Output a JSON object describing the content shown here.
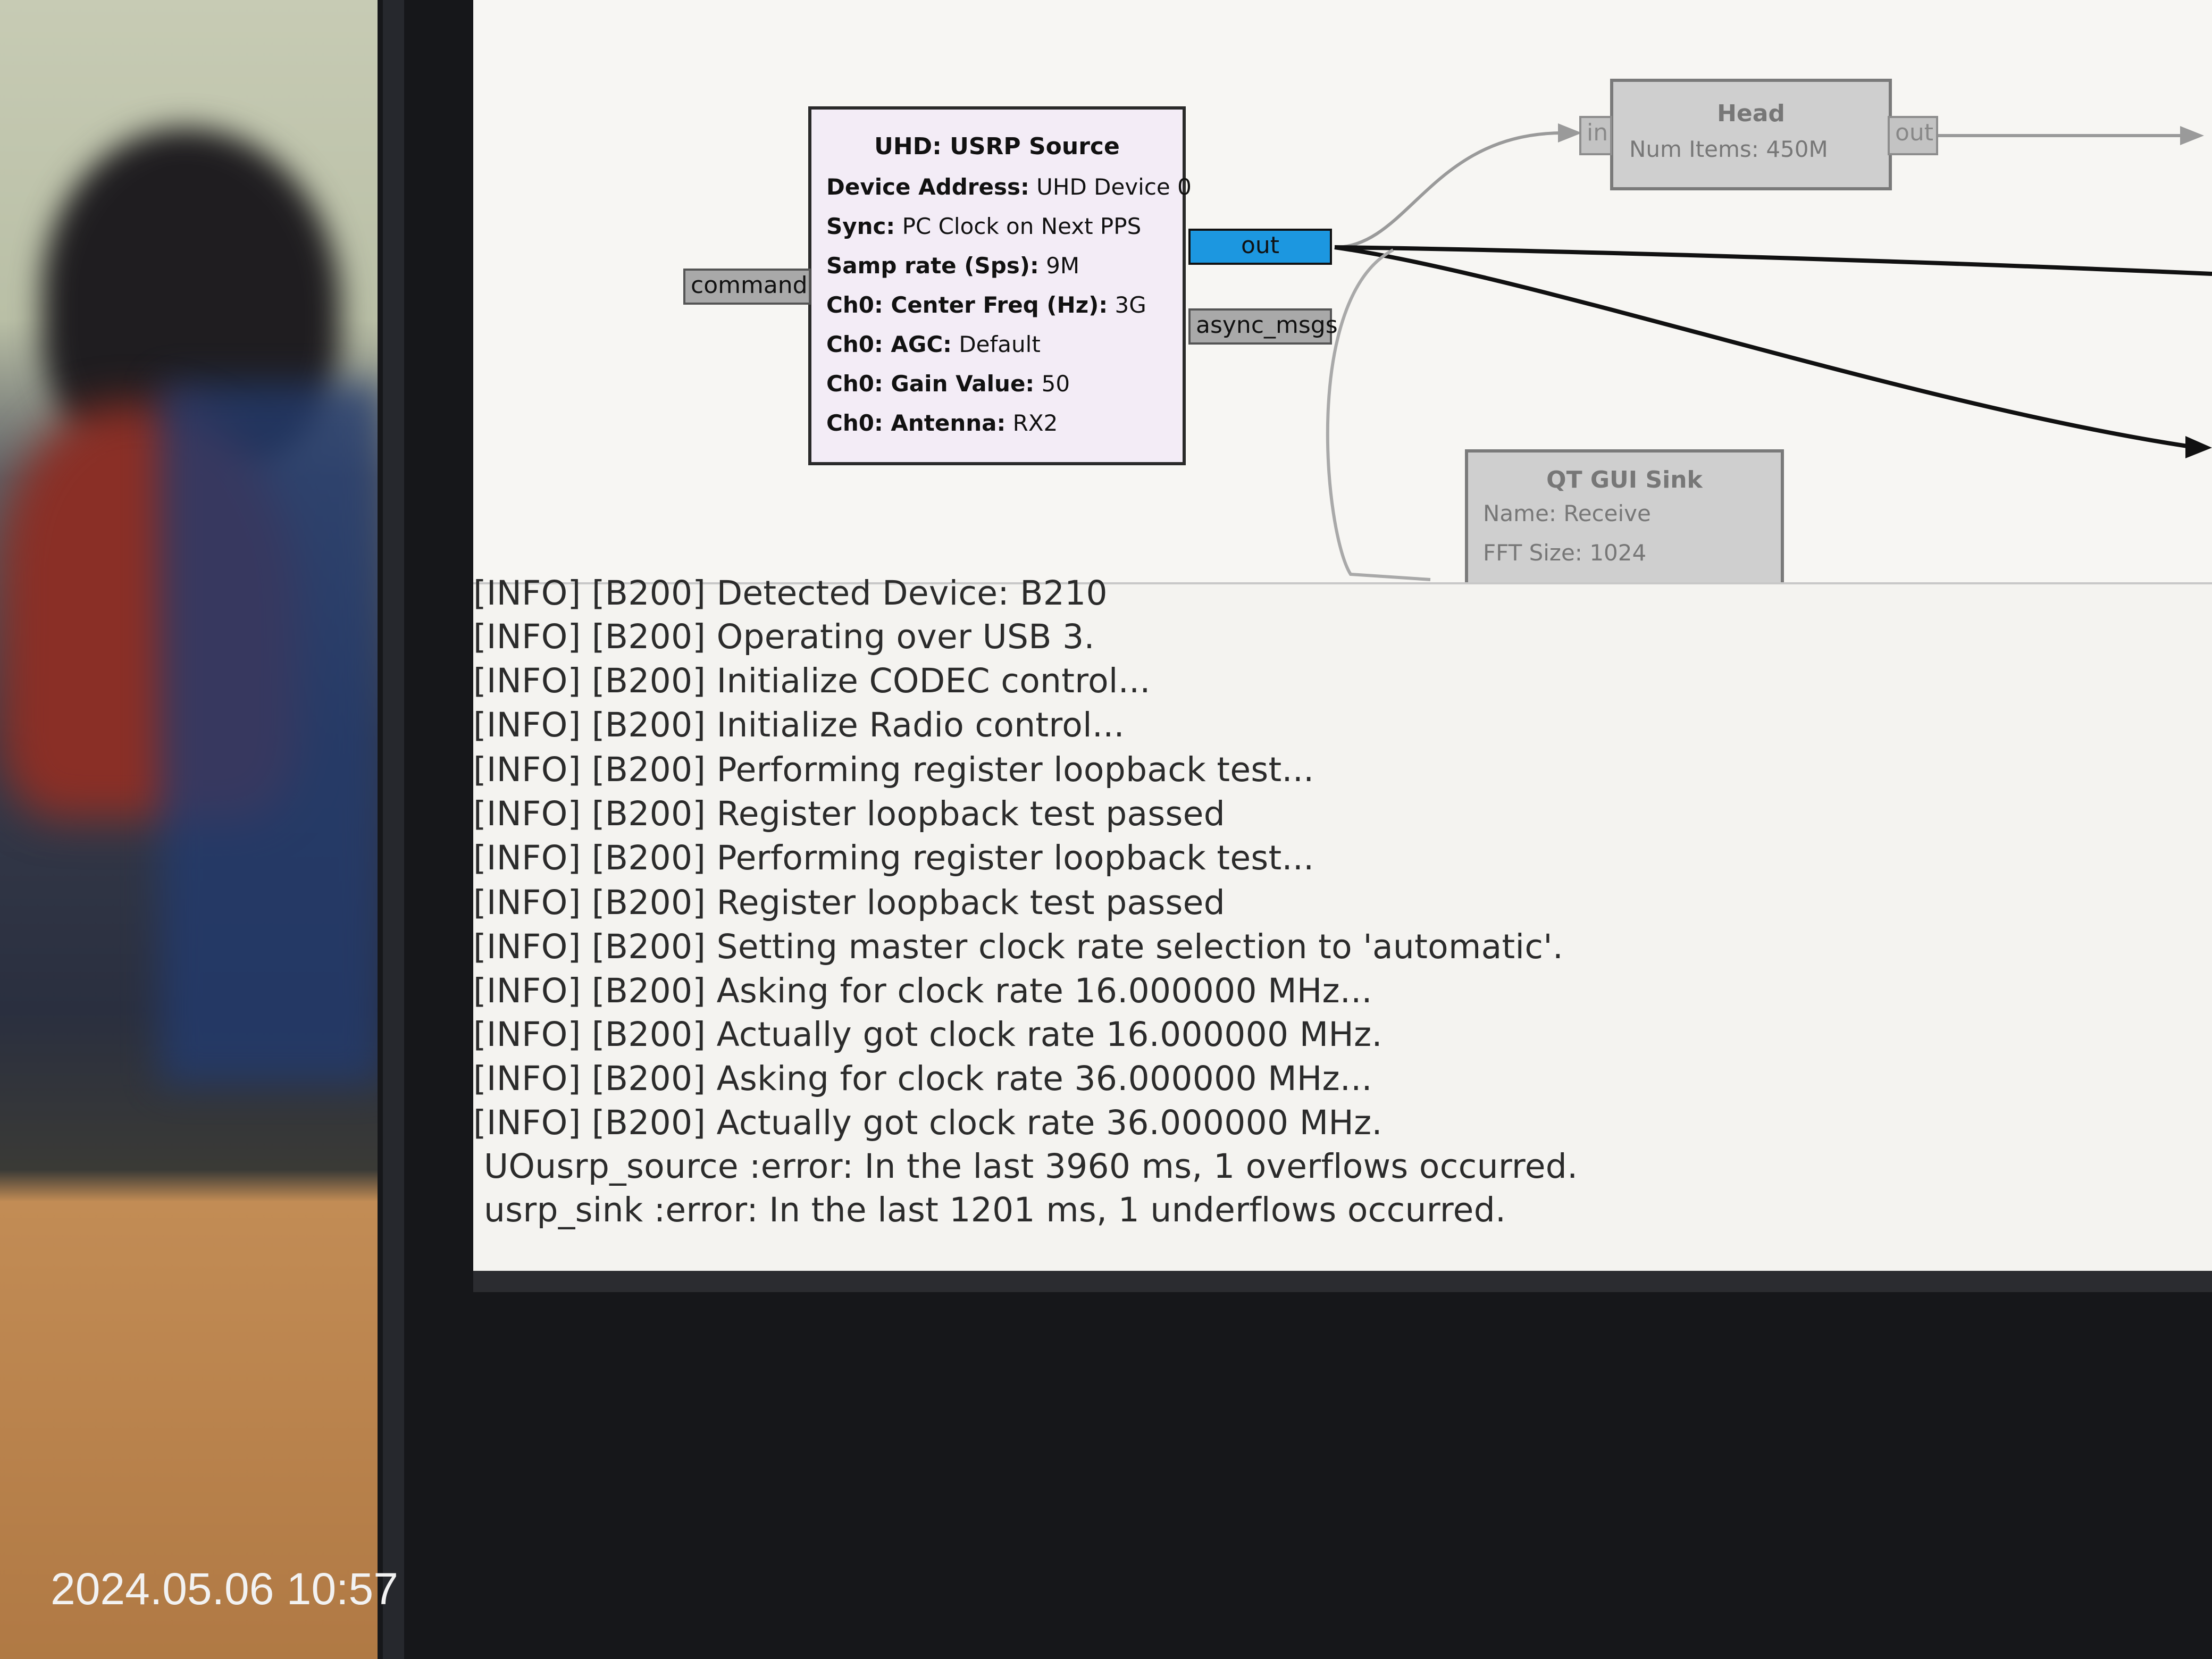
{
  "usrp_source": {
    "title": "UHD: USRP Source",
    "params": [
      {
        "key": "Device Address:",
        "value": "UHD Device 0"
      },
      {
        "key": "Sync:",
        "value": "PC Clock on Next PPS"
      },
      {
        "key": "Samp rate (Sps):",
        "value": "9M"
      },
      {
        "key": "Ch0: Center Freq (Hz):",
        "value": "3G"
      },
      {
        "key": "Ch0: AGC:",
        "value": "Default"
      },
      {
        "key": "Ch0: Gain Value:",
        "value": "50"
      },
      {
        "key": "Ch0: Antenna:",
        "value": "RX2"
      }
    ],
    "port_command": "command",
    "port_out": "out",
    "port_async": "async_msgs"
  },
  "head": {
    "title": "Head",
    "param_key": "Num Items:",
    "param_value": "450M",
    "port_in": "in",
    "port_out": "out"
  },
  "qt_sink": {
    "title": "QT GUI Sink",
    "params": [
      {
        "key": "Name:",
        "value": "Receive"
      },
      {
        "key": "FFT Size:",
        "value": "1024"
      }
    ]
  },
  "console_lines": [
    "[INFO] [B200] Detected Device: B210",
    "[INFO] [B200] Operating over USB 3.",
    "[INFO] [B200] Initialize CODEC control...",
    "[INFO] [B200] Initialize Radio control...",
    "[INFO] [B200] Performing register loopback test...",
    "[INFO] [B200] Register loopback test passed",
    "[INFO] [B200] Performing register loopback test...",
    "[INFO] [B200] Register loopback test passed",
    "[INFO] [B200] Setting master clock rate selection to 'automatic'.",
    "[INFO] [B200] Asking for clock rate 16.000000 MHz...",
    "[INFO] [B200] Actually got clock rate 16.000000 MHz.",
    "[INFO] [B200] Asking for clock rate 36.000000 MHz...",
    "[INFO] [B200] Actually got clock rate 36.000000 MHz.",
    "UOusrp_source :error: In the last 3960 ms, 1 overflows occurred.",
    "usrp_sink :error: In the last 1201 ms, 1 underflows occurred."
  ],
  "photo_timestamp": "2024.05.06 10:57",
  "colors": {
    "port_active": "#1c97e0",
    "block_bg": "#f3ecf6",
    "screen_bg": "#f3f2ef"
  }
}
